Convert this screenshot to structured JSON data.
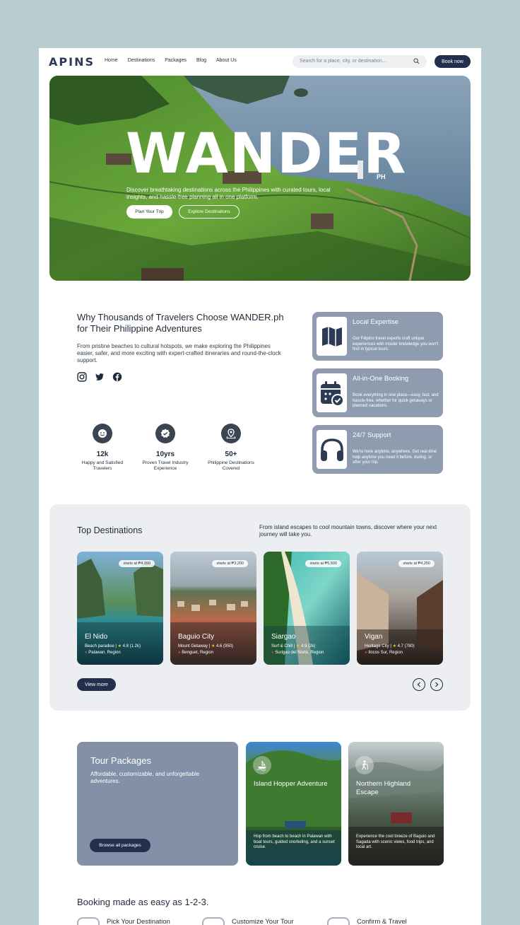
{
  "nav": {
    "logo": "ΑΡΙΝЅ",
    "links": [
      "Home",
      "Destinations",
      "Packages",
      "Blog",
      "About Us"
    ],
    "search_placeholder": "Search for a place, city, or destination...",
    "book_label": "Book now"
  },
  "hero": {
    "title": "WANDER",
    "suffix": "PH",
    "subtitle": "Discover breathtaking destinations across the Philippines with curated tours, local insights, and hassle-free planning all in one platform.",
    "primary_cta": "Plan Your Trip",
    "secondary_cta": "Explore Destinations"
  },
  "why": {
    "title": "Why Thousands of Travelers Choose WANDER.ph for Their Philippine Adventures",
    "description": "From pristine beaches to cultural hotspots, we make exploring the Philippines easier, safer, and more exciting with expert-crafted itineraries and round-the-clock support.",
    "socials": [
      "instagram-icon",
      "twitter-icon",
      "facebook-icon"
    ],
    "stats": [
      {
        "value": "12k",
        "label": "Happy and Satisfied Travelers",
        "icon": "smile-icon"
      },
      {
        "value": "10yrs",
        "label": "Proven Travel Industry Experience",
        "icon": "badge-check-icon"
      },
      {
        "value": "50+",
        "label": "Philippine Destinations Covered",
        "icon": "map-pin-icon"
      }
    ],
    "features": [
      {
        "title": "Local Expertise",
        "text": "Our Filipino travel experts craft unique experiences with insider knowledge you won't find in typical tours.",
        "icon": "map-icon"
      },
      {
        "title": "All-in-One Booking",
        "text": "Book everything in one place—easy, fast, and hassle-free, whether for quick getaways or planned vacations.",
        "icon": "calendar-check-icon"
      },
      {
        "title": "24/7 Support",
        "text": "We're here anytime, anywhere. Get real-time help anytime you need it before, during, or after your trip.",
        "icon": "headphones-icon"
      }
    ]
  },
  "destinations": {
    "title": "Top Destinations",
    "subtitle": "From island escapes to cool mountain towns, discover where your next journey will take you.",
    "cards": [
      {
        "price": "starts at ₱4,999",
        "name": "El Nido",
        "tag": "Beach paradise",
        "rating": "4.8 (1.2k)",
        "location": "Palawan, Region"
      },
      {
        "price": "starts at ₱3,200",
        "name": "Baguio City",
        "tag": "Mount Getaway",
        "rating": "4.6 (950)",
        "location": "Benguet, Region"
      },
      {
        "price": "starts at ₱5,500",
        "name": "Siargao",
        "tag": "Surf & Chill",
        "rating": "4.9 (2k)",
        "location": "Surigao del Norte, Region"
      },
      {
        "price": "starts at ₱4,250",
        "name": "Vigan",
        "tag": "Heritage City",
        "rating": "4.7 (780)",
        "location": "Ilocos Sur, Region"
      }
    ],
    "view_more": "View more"
  },
  "tours": {
    "title": "Tour Packages",
    "subtitle": "Affordable, customizable, and unforgettable adventures.",
    "cta": "Browse all packages",
    "packages": [
      {
        "title": "Island Hopper Adventure",
        "text": "Hop from beach to beach in Palawan with boat tours, guided snorkeling, and a sunset cruise.",
        "icon": "boat-icon"
      },
      {
        "title": "Northern Highland Escape",
        "text": "Experience the cool breeze of Baguio and Sagada with scenic views, food trips, and local art.",
        "icon": "hiker-icon"
      }
    ]
  },
  "steps": {
    "title": "Booking made as easy as 1-2-3.",
    "items": [
      "Pick Your Destination",
      "Customize Your Tour",
      "Confirm & Travel"
    ]
  },
  "colors": {
    "background": "#b9ccd0",
    "navy": "#22304d",
    "card_slate": "#8f9cb0",
    "section_gray": "#eceef1"
  }
}
